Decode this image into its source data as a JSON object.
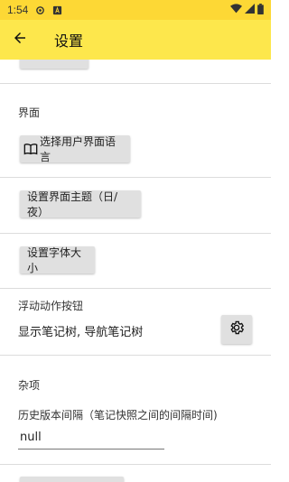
{
  "status_bar": {
    "time": "1:54",
    "icons": [
      "settings-status-icon",
      "notification-a-icon",
      "wifi-icon",
      "signal-icon",
      "battery-icon"
    ]
  },
  "app_bar": {
    "title": "设置",
    "back_icon": "arrow-back-icon"
  },
  "sections": {
    "interface": {
      "label": "界面",
      "language_button": "选择用户界面语言",
      "language_icon": "book-icon",
      "theme_button": "设置界面主题（日/夜）",
      "font_size_button": "设置字体大小"
    },
    "fab": {
      "label": "浮动动作按钮",
      "value": "显示笔记树, 导航笔记树",
      "settings_icon": "gear-icon"
    },
    "misc": {
      "label": "杂项",
      "history_interval_label": "历史版本间隔（笔记快照之间的间隔时间)",
      "history_interval_value": "null"
    }
  },
  "colors": {
    "app_bar": "#fde74c",
    "status_bar": "#fdd835",
    "button_bg": "#e0e0e0"
  }
}
